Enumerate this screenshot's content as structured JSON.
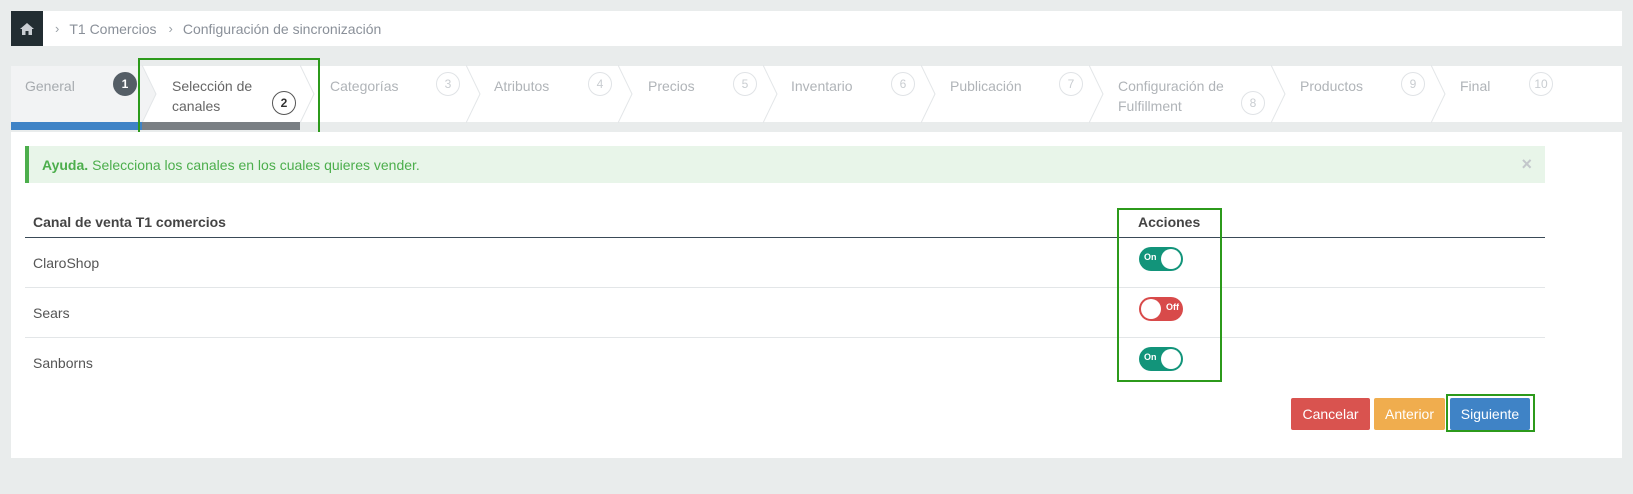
{
  "breadcrumb": {
    "home_icon": "home-icon",
    "items": [
      "T1 Comercios",
      "Configuración de sincronización"
    ],
    "separator": "›"
  },
  "wizard": {
    "steps": [
      {
        "label": "General",
        "num": "1",
        "state": "done"
      },
      {
        "label": "Selección de canales",
        "num": "2",
        "state": "active"
      },
      {
        "label": "Categorías",
        "num": "3",
        "state": "pending"
      },
      {
        "label": "Atributos",
        "num": "4",
        "state": "pending"
      },
      {
        "label": "Precios",
        "num": "5",
        "state": "pending"
      },
      {
        "label": "Inventario",
        "num": "6",
        "state": "pending"
      },
      {
        "label": "Publicación",
        "num": "7",
        "state": "pending"
      },
      {
        "label": "Configuración de Fulfillment",
        "num": "8",
        "state": "pending"
      },
      {
        "label": "Productos",
        "num": "9",
        "state": "pending"
      },
      {
        "label": "Final",
        "num": "10",
        "state": "pending"
      }
    ],
    "accent_color": "#3f83c6"
  },
  "alert": {
    "title": "Ayuda.",
    "message": "Selecciona los canales en los cuales quieres vender.",
    "close": "×"
  },
  "table": {
    "headers": {
      "channel": "Canal de venta T1 comercios",
      "actions": "Acciones"
    },
    "rows": [
      {
        "name": "ClaroShop",
        "state": "on",
        "toggle_label": "On"
      },
      {
        "name": "Sears",
        "state": "off",
        "toggle_label": "Off"
      },
      {
        "name": "Sanborns",
        "state": "on",
        "toggle_label": "On"
      }
    ]
  },
  "buttons": {
    "cancel": "Cancelar",
    "previous": "Anterior",
    "next": "Siguiente"
  },
  "colors": {
    "on": "#12947a",
    "off": "#d84a4a",
    "cancel": "#d9534f",
    "previous": "#f0ad4e",
    "next": "#3f83c6",
    "highlight": "#2c9a1b"
  }
}
